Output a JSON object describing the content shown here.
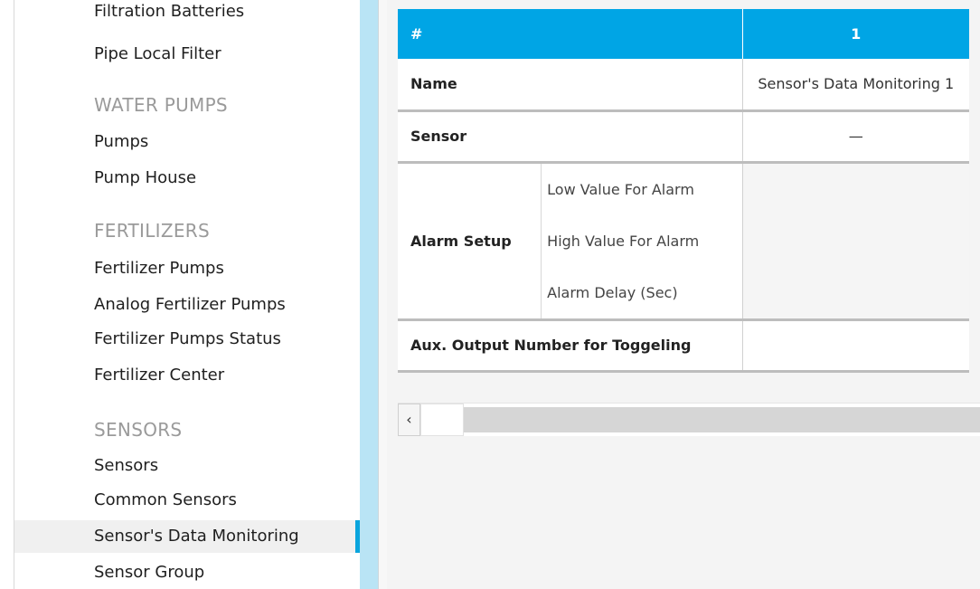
{
  "sidebar": {
    "items": [
      {
        "label": "Filtration Batteries"
      },
      {
        "label": "Pipe Local Filter"
      },
      {
        "label": "Pumps"
      },
      {
        "label": "Pump House"
      },
      {
        "label": "Fertilizer Pumps"
      },
      {
        "label": "Analog Fertilizer Pumps"
      },
      {
        "label": "Fertilizer Pumps Status"
      },
      {
        "label": "Fertilizer Center"
      },
      {
        "label": "Sensors"
      },
      {
        "label": "Common Sensors"
      },
      {
        "label": "Sensor's Data Monitoring"
      },
      {
        "label": "Sensor Group"
      }
    ],
    "sections": [
      {
        "label": "WATER PUMPS"
      },
      {
        "label": "FERTILIZERS"
      },
      {
        "label": "SENSORS"
      }
    ],
    "active_item": "Sensor's Data Monitoring"
  },
  "table": {
    "header": {
      "left": "#",
      "col1": "1"
    },
    "name": {
      "label": "Name",
      "value": "Sensor's Data Monitoring 1"
    },
    "sensor": {
      "label": "Sensor",
      "value": "—"
    },
    "alarm": {
      "label": "Alarm Setup",
      "low": "Low Value For Alarm",
      "high": "High Value For Alarm",
      "delay": "Alarm Delay (Sec)"
    },
    "aux": {
      "label": "Aux. Output Number for Toggeling",
      "value": ""
    }
  },
  "scrollbar": {
    "left_arrow": "‹"
  },
  "colors": {
    "header": "#00a5e5",
    "accent": "#0aa5dd",
    "divider": "#b9e4f5"
  }
}
